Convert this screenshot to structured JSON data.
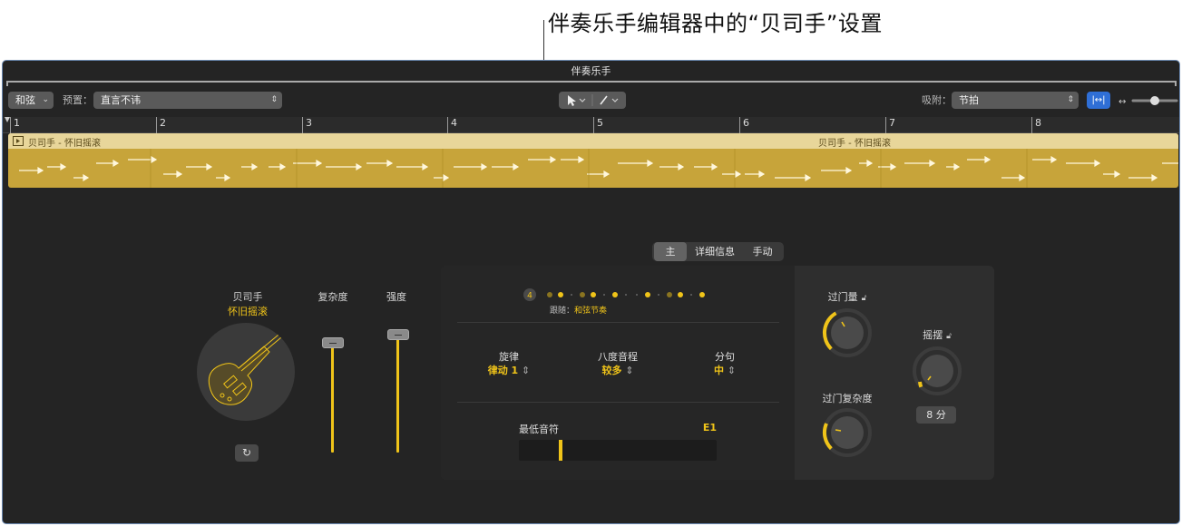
{
  "callout": {
    "text": "伴奏乐手编辑器中的“贝司手”设置"
  },
  "window": {
    "title": "伴奏乐手"
  },
  "toolbar": {
    "chord_label": "和弦",
    "preset_label": "预置：",
    "preset_value": "直言不讳",
    "snap_label": "吸附：",
    "snap_value": "节拍"
  },
  "ruler": {
    "bars": [
      "1",
      "2",
      "3",
      "4",
      "5",
      "6",
      "7",
      "8"
    ]
  },
  "region": {
    "title_1": "贝司手 - 怀旧摇滚",
    "title_2": "贝司手 - 怀旧摇滚"
  },
  "tabs": [
    "主",
    "详细信息",
    "手动"
  ],
  "player": {
    "name": "贝司手",
    "style": "怀旧摇滚"
  },
  "sliders": {
    "complexity_label": "复杂度",
    "complexity_value": 0.88,
    "intensity_label": "强度",
    "intensity_value": 0.94
  },
  "pattern": {
    "count": "4",
    "follow_label": "跟随：",
    "follow_value": "和弦节奏"
  },
  "params": {
    "rhythm_label": "旋律",
    "rhythm_value": "律动 1",
    "octave_label": "八度音程",
    "octave_value": "较多",
    "phrase_label": "分句",
    "phrase_value": "中"
  },
  "lowest_note": {
    "label": "最低音符",
    "value": "E1"
  },
  "knobs": {
    "fill_amount_label": "过门量",
    "fill_complexity_label": "过门复杂度",
    "swing_label": "摇摆",
    "swing_value": "8 分"
  },
  "colors": {
    "accent": "#f0c419",
    "region": "#c7a43a",
    "region_header": "#e8d69a",
    "background": "#242424",
    "selection_blue": "#2f6fd6"
  }
}
